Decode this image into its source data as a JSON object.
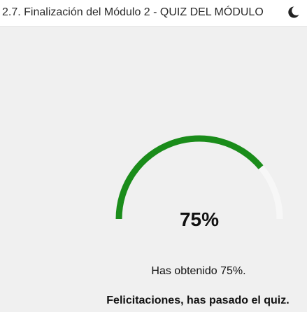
{
  "header": {
    "title": "2.7. Finalización del Módulo 2 - QUIZ DEL MÓDULO",
    "theme_icon": "moon-icon"
  },
  "quiz_result": {
    "progress": 0.75,
    "score_label": "75%",
    "result_message": "Has obtenido 75%.",
    "pass_message": "Felicitaciones, has pasado el quiz.",
    "progress_color": "#1a8c1a",
    "track_color": "#f7f7f7"
  }
}
